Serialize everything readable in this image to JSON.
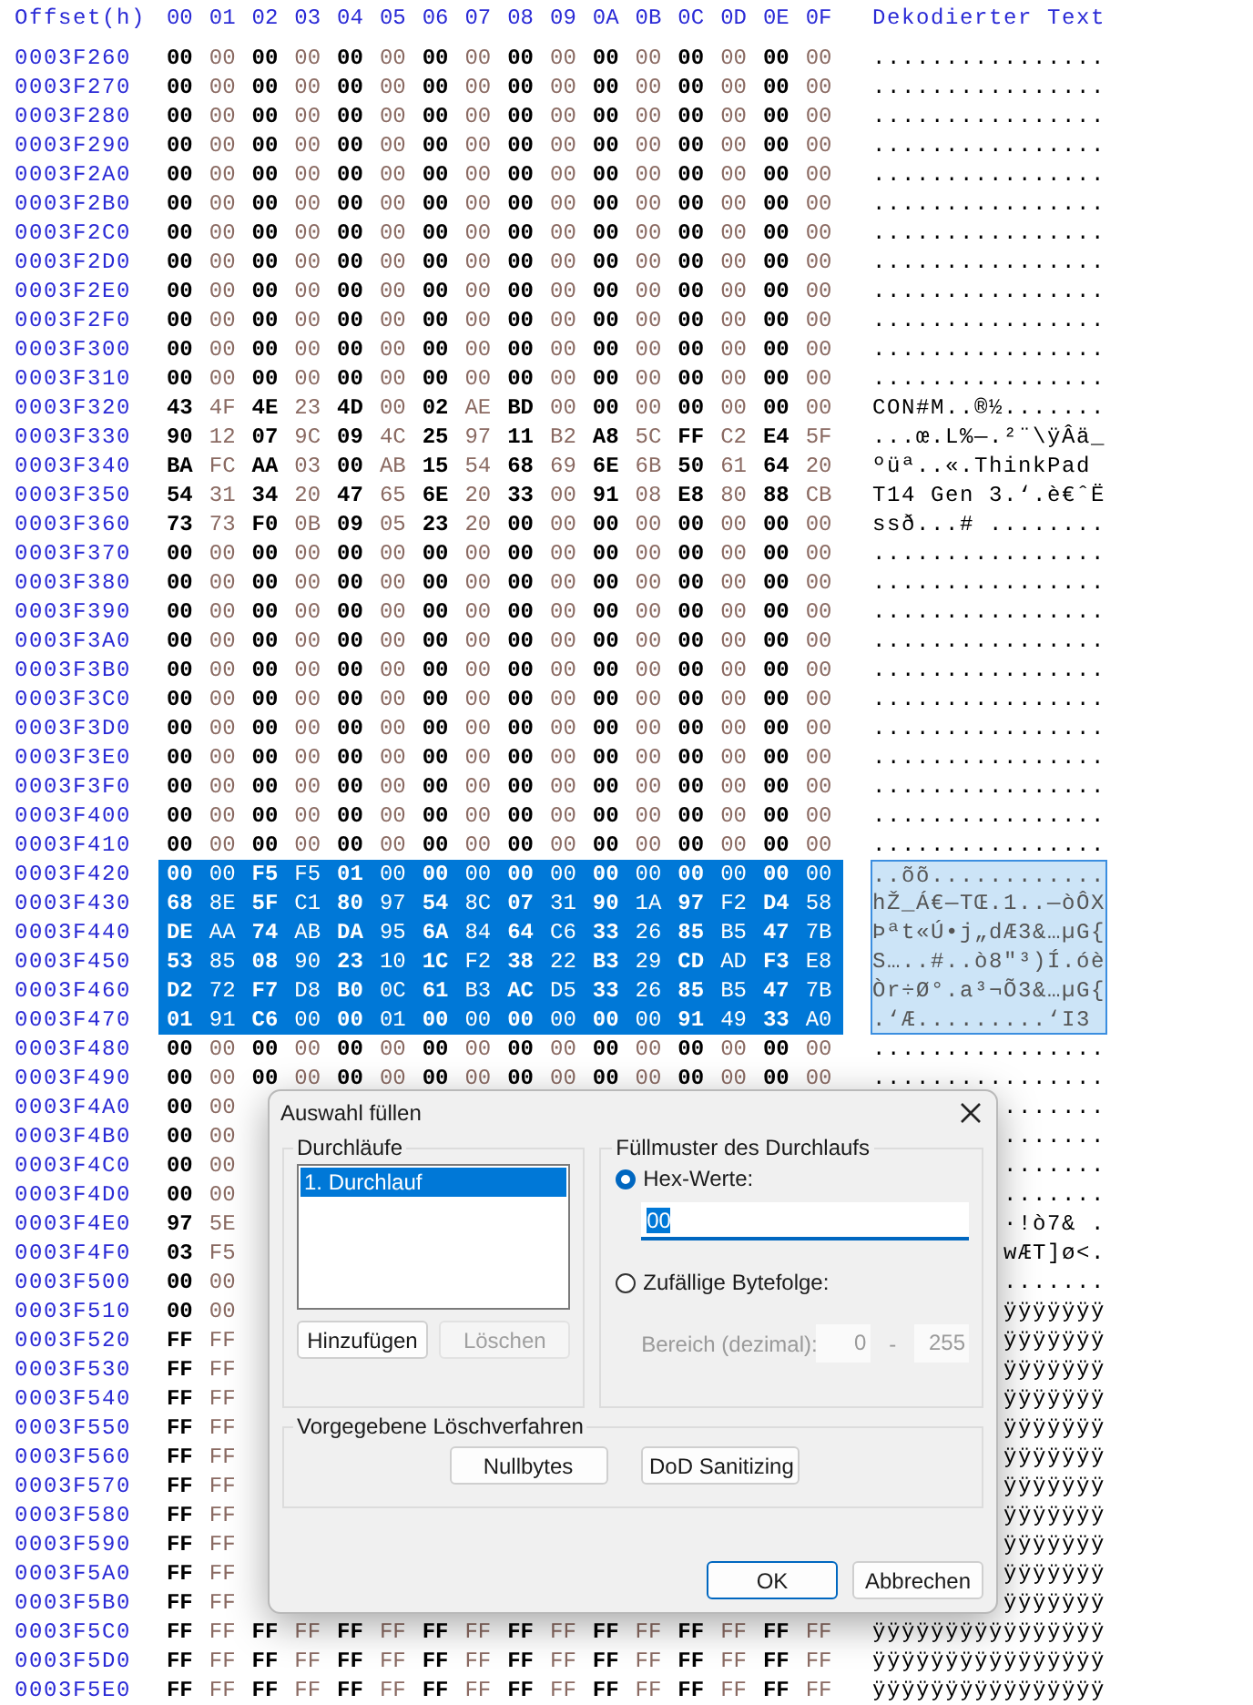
{
  "hex_view": {
    "columns": [
      "Offset(h)",
      "00",
      "01",
      "02",
      "03",
      "04",
      "05",
      "06",
      "07",
      "08",
      "09",
      "0A",
      "0B",
      "0C",
      "0D",
      "0E",
      "0F",
      "Dekodierter Text"
    ],
    "rows": [
      {
        "offset": "0003F260",
        "hex": "00 00 00 00 00 00 00 00 00 00 00 00 00 00 00 00",
        "text": "................",
        "selected": false
      },
      {
        "offset": "0003F270",
        "hex": "00 00 00 00 00 00 00 00 00 00 00 00 00 00 00 00",
        "text": "................",
        "selected": false
      },
      {
        "offset": "0003F280",
        "hex": "00 00 00 00 00 00 00 00 00 00 00 00 00 00 00 00",
        "text": "................",
        "selected": false
      },
      {
        "offset": "0003F290",
        "hex": "00 00 00 00 00 00 00 00 00 00 00 00 00 00 00 00",
        "text": "................",
        "selected": false
      },
      {
        "offset": "0003F2A0",
        "hex": "00 00 00 00 00 00 00 00 00 00 00 00 00 00 00 00",
        "text": "................",
        "selected": false
      },
      {
        "offset": "0003F2B0",
        "hex": "00 00 00 00 00 00 00 00 00 00 00 00 00 00 00 00",
        "text": "................",
        "selected": false
      },
      {
        "offset": "0003F2C0",
        "hex": "00 00 00 00 00 00 00 00 00 00 00 00 00 00 00 00",
        "text": "................",
        "selected": false
      },
      {
        "offset": "0003F2D0",
        "hex": "00 00 00 00 00 00 00 00 00 00 00 00 00 00 00 00",
        "text": "................",
        "selected": false
      },
      {
        "offset": "0003F2E0",
        "hex": "00 00 00 00 00 00 00 00 00 00 00 00 00 00 00 00",
        "text": "................",
        "selected": false
      },
      {
        "offset": "0003F2F0",
        "hex": "00 00 00 00 00 00 00 00 00 00 00 00 00 00 00 00",
        "text": "................",
        "selected": false
      },
      {
        "offset": "0003F300",
        "hex": "00 00 00 00 00 00 00 00 00 00 00 00 00 00 00 00",
        "text": "................",
        "selected": false
      },
      {
        "offset": "0003F310",
        "hex": "00 00 00 00 00 00 00 00 00 00 00 00 00 00 00 00",
        "text": "................",
        "selected": false
      },
      {
        "offset": "0003F320",
        "hex": "43 4F 4E 23 4D 00 02 AE BD 00 00 00 00 00 00 00",
        "text": "CON#M..®½.......",
        "selected": false
      },
      {
        "offset": "0003F330",
        "hex": "90 12 07 9C 09 4C 25 97 11 B2 A8 5C FF C2 E4 5F",
        "text": "...œ.L%—.²¨\\ÿÂä_",
        "selected": false
      },
      {
        "offset": "0003F340",
        "hex": "BA FC AA 03 00 AB 15 54 68 69 6E 6B 50 61 64 20",
        "text": "ºüª..«.ThinkPad",
        "selected": false
      },
      {
        "offset": "0003F350",
        "hex": "54 31 34 20 47 65 6E 20 33 00 91 08 E8 80 88 CB",
        "text": "T14 Gen 3.‘.è€ˆË",
        "selected": false
      },
      {
        "offset": "0003F360",
        "hex": "73 73 F0 0B 09 05 23 20 00 00 00 00 00 00 00 00",
        "text": "ssð...# ........",
        "selected": false
      },
      {
        "offset": "0003F370",
        "hex": "00 00 00 00 00 00 00 00 00 00 00 00 00 00 00 00",
        "text": "................",
        "selected": false
      },
      {
        "offset": "0003F380",
        "hex": "00 00 00 00 00 00 00 00 00 00 00 00 00 00 00 00",
        "text": "................",
        "selected": false
      },
      {
        "offset": "0003F390",
        "hex": "00 00 00 00 00 00 00 00 00 00 00 00 00 00 00 00",
        "text": "................",
        "selected": false
      },
      {
        "offset": "0003F3A0",
        "hex": "00 00 00 00 00 00 00 00 00 00 00 00 00 00 00 00",
        "text": "................",
        "selected": false
      },
      {
        "offset": "0003F3B0",
        "hex": "00 00 00 00 00 00 00 00 00 00 00 00 00 00 00 00",
        "text": "................",
        "selected": false
      },
      {
        "offset": "0003F3C0",
        "hex": "00 00 00 00 00 00 00 00 00 00 00 00 00 00 00 00",
        "text": "................",
        "selected": false
      },
      {
        "offset": "0003F3D0",
        "hex": "00 00 00 00 00 00 00 00 00 00 00 00 00 00 00 00",
        "text": "................",
        "selected": false
      },
      {
        "offset": "0003F3E0",
        "hex": "00 00 00 00 00 00 00 00 00 00 00 00 00 00 00 00",
        "text": "................",
        "selected": false
      },
      {
        "offset": "0003F3F0",
        "hex": "00 00 00 00 00 00 00 00 00 00 00 00 00 00 00 00",
        "text": "................",
        "selected": false
      },
      {
        "offset": "0003F400",
        "hex": "00 00 00 00 00 00 00 00 00 00 00 00 00 00 00 00",
        "text": "................",
        "selected": false
      },
      {
        "offset": "0003F410",
        "hex": "00 00 00 00 00 00 00 00 00 00 00 00 00 00 00 00",
        "text": "................",
        "selected": false
      },
      {
        "offset": "0003F420",
        "hex": "00 00 F5 F5 01 00 00 00 00 00 00 00 00 00 00 00",
        "text": "..õõ............",
        "selected": true
      },
      {
        "offset": "0003F430",
        "hex": "68 8E 5F C1 80 97 54 8C 07 31 90 1A 97 F2 D4 58",
        "text": "hŽ_Á€—TŒ.1..—òÔX",
        "selected": true
      },
      {
        "offset": "0003F440",
        "hex": "DE AA 74 AB DA 95 6A 84 64 C6 33 26 85 B5 47 7B",
        "text": "Þªt«Ú•j„dÆ3&…µG{",
        "selected": true
      },
      {
        "offset": "0003F450",
        "hex": "53 85 08 90 23 10 1C F2 38 22 B3 29 CD AD F3 E8",
        "text": "S…..#..ò8\"³)Í.óè",
        "selected": true
      },
      {
        "offset": "0003F460",
        "hex": "D2 72 F7 D8 B0 0C 61 B3 AC D5 33 26 85 B5 47 7B",
        "text": "Òr÷Ø°.a³¬Õ3&…µG{",
        "selected": true
      },
      {
        "offset": "0003F470",
        "hex": "01 91 C6 00 00 01 00 00 00 00 00 00 91 49 33 A0",
        "text": ".‘Æ.........‘I3",
        "selected": true
      },
      {
        "offset": "0003F480",
        "hex": "00 00 00 00 00 00 00 00 00 00 00 00 00 00 00 00",
        "text": "................",
        "selected": false
      },
      {
        "offset": "0003F490",
        "hex": "00 00 00 00 00 00 00 00 00 00 00 00 00 00 00 00",
        "text": "................",
        "selected": false
      },
      {
        "offset": "0003F4A0",
        "hex": "00 00",
        "text": ".......",
        "selected": false,
        "covered": true
      },
      {
        "offset": "0003F4B0",
        "hex": "00 00",
        "text": ".......",
        "selected": false,
        "covered": true
      },
      {
        "offset": "0003F4C0",
        "hex": "00 00",
        "text": ".......",
        "selected": false,
        "covered": true
      },
      {
        "offset": "0003F4D0",
        "hex": "00 00",
        "text": ".......",
        "selected": false,
        "covered": true
      },
      {
        "offset": "0003F4E0",
        "hex": "97 5E",
        "text": "·!ò7& .",
        "selected": false,
        "covered": true
      },
      {
        "offset": "0003F4F0",
        "hex": "03 F5",
        "text": "wÆT]ø<.",
        "selected": false,
        "covered": true
      },
      {
        "offset": "0003F500",
        "hex": "00 00",
        "text": ".......",
        "selected": false,
        "covered": true
      },
      {
        "offset": "0003F510",
        "hex": "00 00",
        "text": "ÿÿÿÿÿÿÿ",
        "selected": false,
        "covered": true
      },
      {
        "offset": "0003F520",
        "hex": "FF FF",
        "text": "ÿÿÿÿÿÿÿ",
        "selected": false,
        "covered": true
      },
      {
        "offset": "0003F530",
        "hex": "FF FF",
        "text": "ÿÿÿÿÿÿÿ",
        "selected": false,
        "covered": true
      },
      {
        "offset": "0003F540",
        "hex": "FF FF",
        "text": "ÿÿÿÿÿÿÿ",
        "selected": false,
        "covered": true
      },
      {
        "offset": "0003F550",
        "hex": "FF FF",
        "text": "ÿÿÿÿÿÿÿ",
        "selected": false,
        "covered": true
      },
      {
        "offset": "0003F560",
        "hex": "FF FF",
        "text": "ÿÿÿÿÿÿÿ",
        "selected": false,
        "covered": true
      },
      {
        "offset": "0003F570",
        "hex": "FF FF",
        "text": "ÿÿÿÿÿÿÿ",
        "selected": false,
        "covered": true
      },
      {
        "offset": "0003F580",
        "hex": "FF FF",
        "text": "ÿÿÿÿÿÿÿ",
        "selected": false,
        "covered": true
      },
      {
        "offset": "0003F590",
        "hex": "FF FF",
        "text": "ÿÿÿÿÿÿÿ",
        "selected": false,
        "covered": true
      },
      {
        "offset": "0003F5A0",
        "hex": "FF FF",
        "text": "ÿÿÿÿÿÿÿ",
        "selected": false,
        "covered": true
      },
      {
        "offset": "0003F5B0",
        "hex": "FF FF",
        "text": "ÿÿÿÿÿÿÿ",
        "selected": false,
        "covered": true
      },
      {
        "offset": "0003F5C0",
        "hex": "FF FF FF FF FF FF FF FF FF FF FF FF FF FF FF FF",
        "text": "ÿÿÿÿÿÿÿÿÿÿÿÿÿÿÿÿ",
        "selected": false
      },
      {
        "offset": "0003F5D0",
        "hex": "FF FF FF FF FF FF FF FF FF FF FF FF FF FF FF FF",
        "text": "ÿÿÿÿÿÿÿÿÿÿÿÿÿÿÿÿ",
        "selected": false
      },
      {
        "offset": "0003F5E0",
        "hex": "FF FF FF FF FF FF FF FF FF FF FF FF FF FF FF FF",
        "text": "ÿÿÿÿÿÿÿÿÿÿÿÿÿÿÿÿ",
        "selected": false
      }
    ]
  },
  "dialog": {
    "title": "Auswahl füllen",
    "passes": {
      "legend": "Durchläufe",
      "items": [
        {
          "label": "1. Durchlauf",
          "selected": true
        }
      ],
      "buttons": [
        {
          "label": "Hinzufügen",
          "disabled": false
        },
        {
          "label": "Löschen",
          "disabled": true
        }
      ]
    },
    "pattern": {
      "legend": "Füllmuster des Durchlaufs",
      "options": [
        {
          "label": "Hex-Werte:",
          "selected": true
        },
        {
          "label": "Zufällige Bytefolge:",
          "selected": false
        }
      ],
      "hex_value": "00",
      "range": {
        "label": "Bereich (dezimal):",
        "from": "0",
        "separator": "-",
        "to": "255",
        "disabled": true
      }
    },
    "presets": {
      "legend": "Vorgegebene Löschverfahren",
      "buttons": [
        "Nullbytes",
        "DoD Sanitizing"
      ]
    },
    "footer_buttons": [
      {
        "label": "OK",
        "default": true
      },
      {
        "label": "Abbrechen",
        "default": false
      }
    ]
  }
}
